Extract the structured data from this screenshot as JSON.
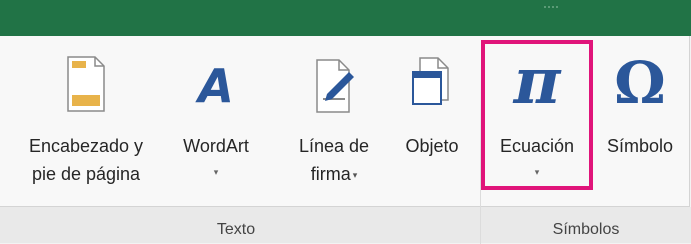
{
  "ribbon": {
    "commands": [
      {
        "id": "encabezado",
        "label_line1": "Encabezado y",
        "label_line2": "pie de página"
      },
      {
        "id": "wordart",
        "label_line1": "WordArt",
        "caret": "▾"
      },
      {
        "id": "linea_firma",
        "label_line1": "Línea de",
        "label_line2": "firma",
        "caret": "▾"
      },
      {
        "id": "objeto",
        "label_line1": "Objeto"
      },
      {
        "id": "ecuacion",
        "label_line1": "Ecuación",
        "caret": "▾",
        "icon_glyph": "π"
      },
      {
        "id": "simbolo",
        "label_line1": "Símbolo",
        "icon_glyph": "Ω"
      }
    ],
    "groups": [
      {
        "label": "Texto"
      },
      {
        "label": "Símbolos"
      }
    ]
  },
  "colors": {
    "title_bar": "#217346",
    "accent_blue": "#2b579a",
    "highlight": "#e0147a"
  },
  "icons": [
    "header-footer-icon",
    "wordart-icon",
    "signature-line-icon",
    "object-icon",
    "equation-icon",
    "symbol-icon"
  ]
}
